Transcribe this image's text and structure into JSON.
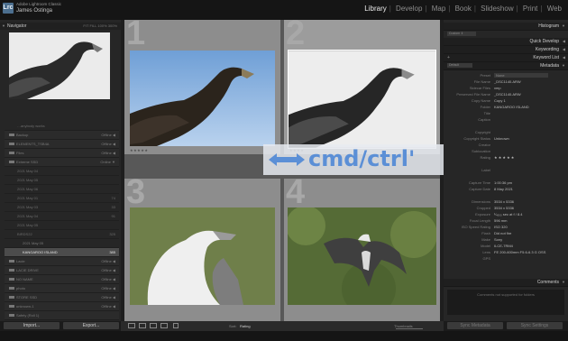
{
  "app": {
    "logo": "Lrc",
    "name": "Adobe Lightroom Classic",
    "user": "James Ostinga"
  },
  "modules": [
    {
      "label": "Library",
      "active": true
    },
    {
      "label": "Develop",
      "active": false
    },
    {
      "label": "Map",
      "active": false
    },
    {
      "label": "Book",
      "active": false
    },
    {
      "label": "Slideshow",
      "active": false
    },
    {
      "label": "Print",
      "active": false
    },
    {
      "label": "Web",
      "active": false
    }
  ],
  "navigator": {
    "title": "Navigator",
    "options": "FIT  FILL  100%  300%"
  },
  "folders": [
    {
      "label": "…anybody works",
      "right": "",
      "type": "sub"
    },
    {
      "label": "Backup",
      "right": "Offline ◀",
      "type": "top"
    },
    {
      "label": "ELEMENTS_TSB4A",
      "right": "Offline ◀",
      "type": "top"
    },
    {
      "label": "Files",
      "right": "Offline ◀",
      "type": "top"
    },
    {
      "label": "Extreme SSD",
      "right": "Online ▼",
      "type": "top"
    },
    {
      "label": "2021 May 04",
      "right": "",
      "type": "sub"
    },
    {
      "label": "2021 May 05",
      "right": "",
      "type": "sub"
    },
    {
      "label": "2021 May 06",
      "right": "",
      "type": "sub"
    },
    {
      "label": "2021 May 01",
      "right": "74",
      "type": "sub"
    },
    {
      "label": "2021 May 03",
      "right": "33",
      "type": "sub"
    },
    {
      "label": "2021 May 04",
      "right": "91",
      "type": "sub"
    },
    {
      "label": "2021 May 05",
      "right": "",
      "type": "sub"
    },
    {
      "label": "BIRDS22",
      "right": "325",
      "type": "sub"
    },
    {
      "label": "2021 May 05",
      "right": "",
      "type": "sub2"
    },
    {
      "label": "KANGAROO ISLAND",
      "right": "385",
      "type": "sel"
    },
    {
      "label": "Lacie",
      "right": "Offline ◀",
      "type": "top"
    },
    {
      "label": "LACIE DRIVE",
      "right": "Offline ◀",
      "type": "top"
    },
    {
      "label": "NO NAME",
      "right": "Offline ◀",
      "type": "top"
    },
    {
      "label": "photo",
      "right": "Offline ◀",
      "type": "top"
    },
    {
      "label": "STORE SSD",
      "right": "Offline ◀",
      "type": "top"
    },
    {
      "label": "unknown-1",
      "right": "Offline ◀",
      "type": "top"
    },
    {
      "label": "Safety (Roll 1)",
      "right": "",
      "type": "top"
    }
  ],
  "left_buttons": {
    "import": "Import...",
    "export": "Export..."
  },
  "grid": {
    "cells": [
      {
        "num": "1",
        "stars": "★★★★★"
      },
      {
        "num": "2",
        "stars": "★★★★"
      },
      {
        "num": "3",
        "stars": ""
      },
      {
        "num": "4",
        "stars": ""
      }
    ]
  },
  "overlay": {
    "text": "cmd/ctrl'",
    "color": "#5b8fd6"
  },
  "toolbar": {
    "sort_label": "Sort:",
    "sort_value": "Rating",
    "thumbnails_label": "Thumbnails"
  },
  "right_panel": {
    "histogram": "Histogram",
    "quick_develop": "Quick Develop",
    "keywording": "Keywording",
    "keyword_list": "Keyword List",
    "metadata": "Metadata",
    "comments": "Comments",
    "comments_placeholder": "Comments not supported for folders",
    "preset_label": "Preset",
    "preset_value": "None",
    "default_label": "Default",
    "rows": [
      {
        "label": "File Name",
        "value": "_DSC1140.ARW"
      },
      {
        "label": "Sidecar Files",
        "value": "xmp"
      },
      {
        "label": "Preserved File Name",
        "value": "_DSC1140.ARW"
      },
      {
        "label": "Copy Name",
        "value": "Copy 1"
      },
      {
        "label": "Folder",
        "value": "KANGAROO ISLAND"
      },
      {
        "label": "Title",
        "value": ""
      },
      {
        "label": "Caption",
        "value": ""
      },
      {
        "label": "",
        "value": ""
      },
      {
        "label": "Copyright",
        "value": ""
      },
      {
        "label": "Copyright Status",
        "value": "Unknown"
      },
      {
        "label": "Creator",
        "value": ""
      },
      {
        "label": "Sublocation",
        "value": ""
      },
      {
        "label": "Rating",
        "value": "★ ★ ★ ★ ★"
      },
      {
        "label": "",
        "value": ""
      },
      {
        "label": "Label",
        "value": ""
      },
      {
        "label": "",
        "value": ""
      },
      {
        "label": "Capture Time",
        "value": "1:00:36 pm"
      },
      {
        "label": "Capture Date",
        "value": "8 May 2021"
      },
      {
        "label": "",
        "value": ""
      },
      {
        "label": "Dimensions",
        "value": "3534 x 5336"
      },
      {
        "label": "Cropped",
        "value": "3534 x 5336"
      },
      {
        "label": "Exposure",
        "value": "¹⁄₄₀₀₀ sec at f / 8.4"
      },
      {
        "label": "Focal Length",
        "value": "596 mm"
      },
      {
        "label": "ISO Speed Rating",
        "value": "ISO 320"
      },
      {
        "label": "Flash",
        "value": "Did not fire"
      },
      {
        "label": "Make",
        "value": "Sony"
      },
      {
        "label": "Model",
        "value": "ILCE-7RM4"
      },
      {
        "label": "Lens",
        "value": "FE 200-600mm F5.6-6.3 G OSS"
      },
      {
        "label": "GPS",
        "value": ""
      }
    ],
    "buttons": {
      "sync_metadata": "Sync Metadata",
      "sync_settings": "Sync Settings"
    }
  }
}
